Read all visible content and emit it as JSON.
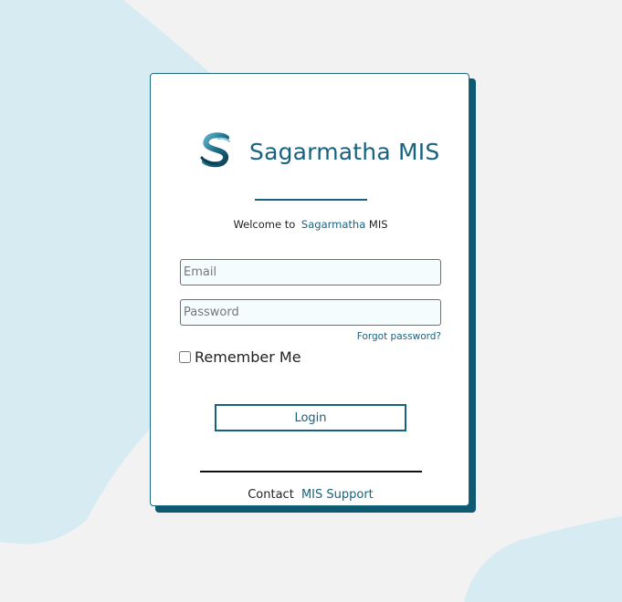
{
  "colors": {
    "accent": "#17627f",
    "card_shadow": "#0f5a72",
    "page_background": "#f2f2f2",
    "blob": "#d7ebf2",
    "input_background": "#f4fcfd"
  },
  "brand": {
    "logo_icon": "sagarmatha-s-logo-icon",
    "name": "Sagarmatha MIS"
  },
  "welcome": {
    "prefix": "Welcome to",
    "brand": "Sagarmatha",
    "suffix": "MIS"
  },
  "form": {
    "email_placeholder": "Email",
    "email_value": "",
    "password_placeholder": "Password",
    "password_value": "",
    "forgot_password_label": "Forgot password?",
    "remember_me_label": "Remember Me",
    "remember_me_checked": false,
    "login_label": "Login"
  },
  "footer": {
    "contact_label": "Contact",
    "support_link_label": "MIS Support"
  }
}
